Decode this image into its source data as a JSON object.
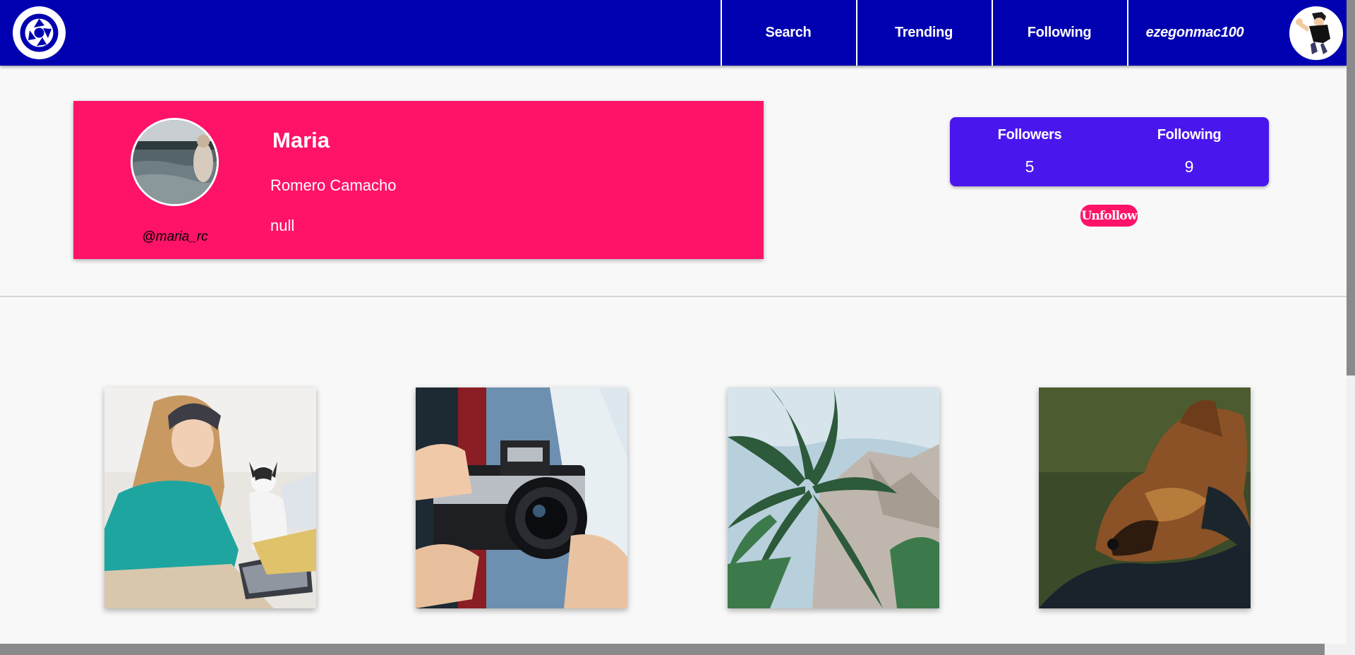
{
  "navbar": {
    "logo_icon": "camera-shutter-logo",
    "links": [
      {
        "label": "Search"
      },
      {
        "label": "Trending"
      },
      {
        "label": "Following"
      }
    ],
    "current_user": "ezegonmac100",
    "avatar_icon": "user-avatar",
    "background_color": "#0000b0"
  },
  "profile": {
    "first_name": "Maria",
    "last_name": "Romero Camacho",
    "bio": "null",
    "handle": "@maria_rc",
    "card_color": "#ff1368"
  },
  "stats": {
    "followers_label": "Followers",
    "followers_count": "5",
    "following_label": "Following",
    "following_count": "9",
    "panel_color": "#4a16ee"
  },
  "actions": {
    "unfollow_label": "Unfollow"
  },
  "gallery": {
    "photos": [
      {
        "subject": "woman-with-laptop-and-dog"
      },
      {
        "subject": "hands-holding-nikon-camera"
      },
      {
        "subject": "palm-trees-and-mountains"
      },
      {
        "subject": "german-shepherd-dog"
      }
    ]
  }
}
